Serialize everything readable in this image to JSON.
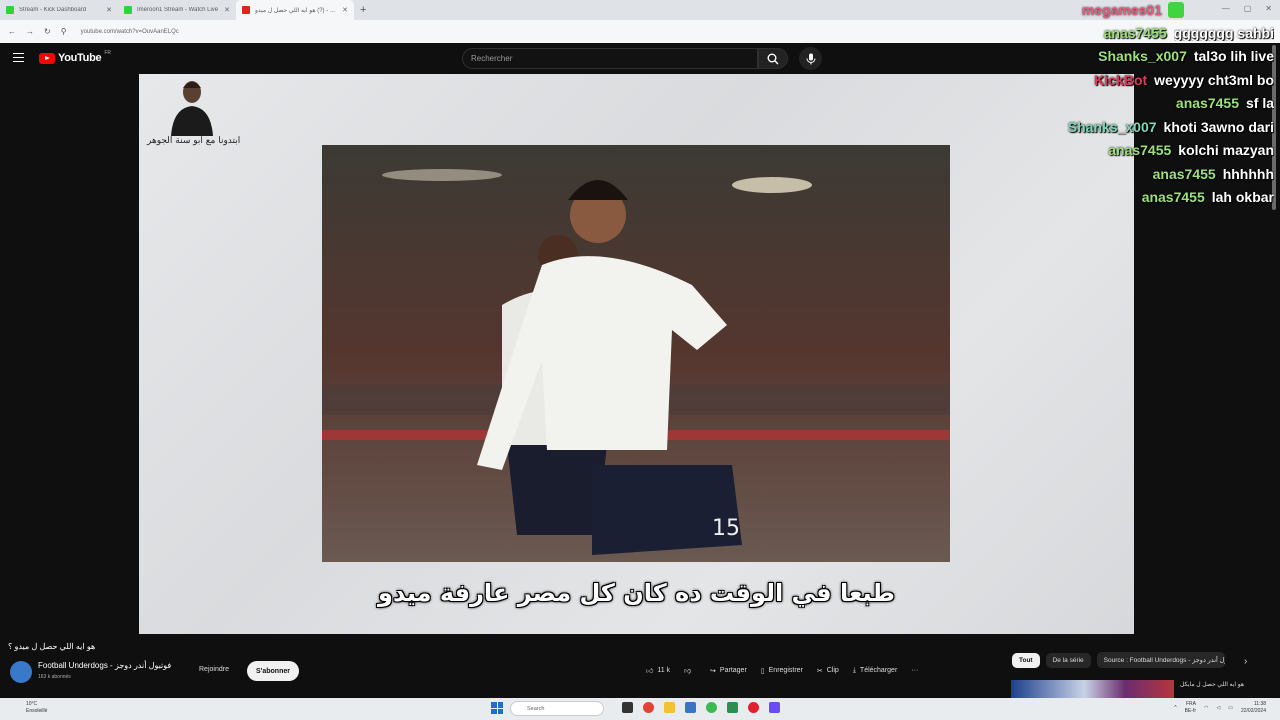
{
  "browser": {
    "tabs": [
      {
        "label": "Stream - Kick Dashboard",
        "icon": "kick-icon",
        "active": false
      },
      {
        "label": "Imeroon1 Stream - Watch Live",
        "icon": "kick-icon",
        "active": false
      },
      {
        "label": "هو ايه اللي حصل ل ميدو (?) - You",
        "icon": "youtube-icon",
        "active": true
      }
    ],
    "url": "youtube.com/watch?v=OuvAanELQc"
  },
  "youtube": {
    "logo_text": "YouTube",
    "region": "FR",
    "search_placeholder": "Rechercher"
  },
  "video": {
    "channel_script": "ابتدونا مع ابو سنة الجوهر",
    "subtitle": "طبعا في الوقت ده كان كل مصر عارفة ميدو"
  },
  "chat": {
    "top_user": "megames01",
    "messages": [
      {
        "user": "anas7455",
        "message": "ggggggg sahbi",
        "color": "#9de07a"
      },
      {
        "user": "Shanks_x007",
        "message": "tal3o lih live",
        "color": "#9de07a"
      },
      {
        "user": "KickBot",
        "message": "weyyyy cht3ml bo",
        "color": "#d83a5a"
      },
      {
        "user": "anas7455",
        "message": "sf la",
        "color": "#9de07a"
      },
      {
        "user": "Shanks_x007",
        "message": "khoti 3awno dari",
        "color": "#7fd7b5"
      },
      {
        "user": "anas7455",
        "message": "kolchi mazyan",
        "color": "#9de07a"
      },
      {
        "user": "anas7455",
        "message": "hhhhhh",
        "color": "#9de07a"
      },
      {
        "user": "anas7455",
        "message": "lah okbar",
        "color": "#9de07a"
      }
    ]
  },
  "below": {
    "title": "هو ايه اللي حصل ل ميدو ؟",
    "channel_name": "Football Underdogs - فوتبول أندر دوجز",
    "subscribers": "163 k abonnés",
    "join_label": "Rejoindre",
    "subscribe_label": "S'abonner",
    "likes": "11 k",
    "share_label": "Partager",
    "save_label": "Enregistrer",
    "clip_label": "Clip",
    "download_label": "Télécharger",
    "more_label": "···",
    "chips": [
      "Tout",
      "De la série",
      "Source : Football Underdogs - فوتبول أندر دوجز"
    ],
    "rec_title": "هو ايه اللي حصل ل مايكل"
  },
  "taskbar": {
    "weather_temp": "10°C",
    "weather_desc": "Ensoleillé",
    "search_label": "Search",
    "lang": "FRA",
    "lang_sub": "BE-fr",
    "time": "11:38",
    "date": "22/02/2024"
  }
}
